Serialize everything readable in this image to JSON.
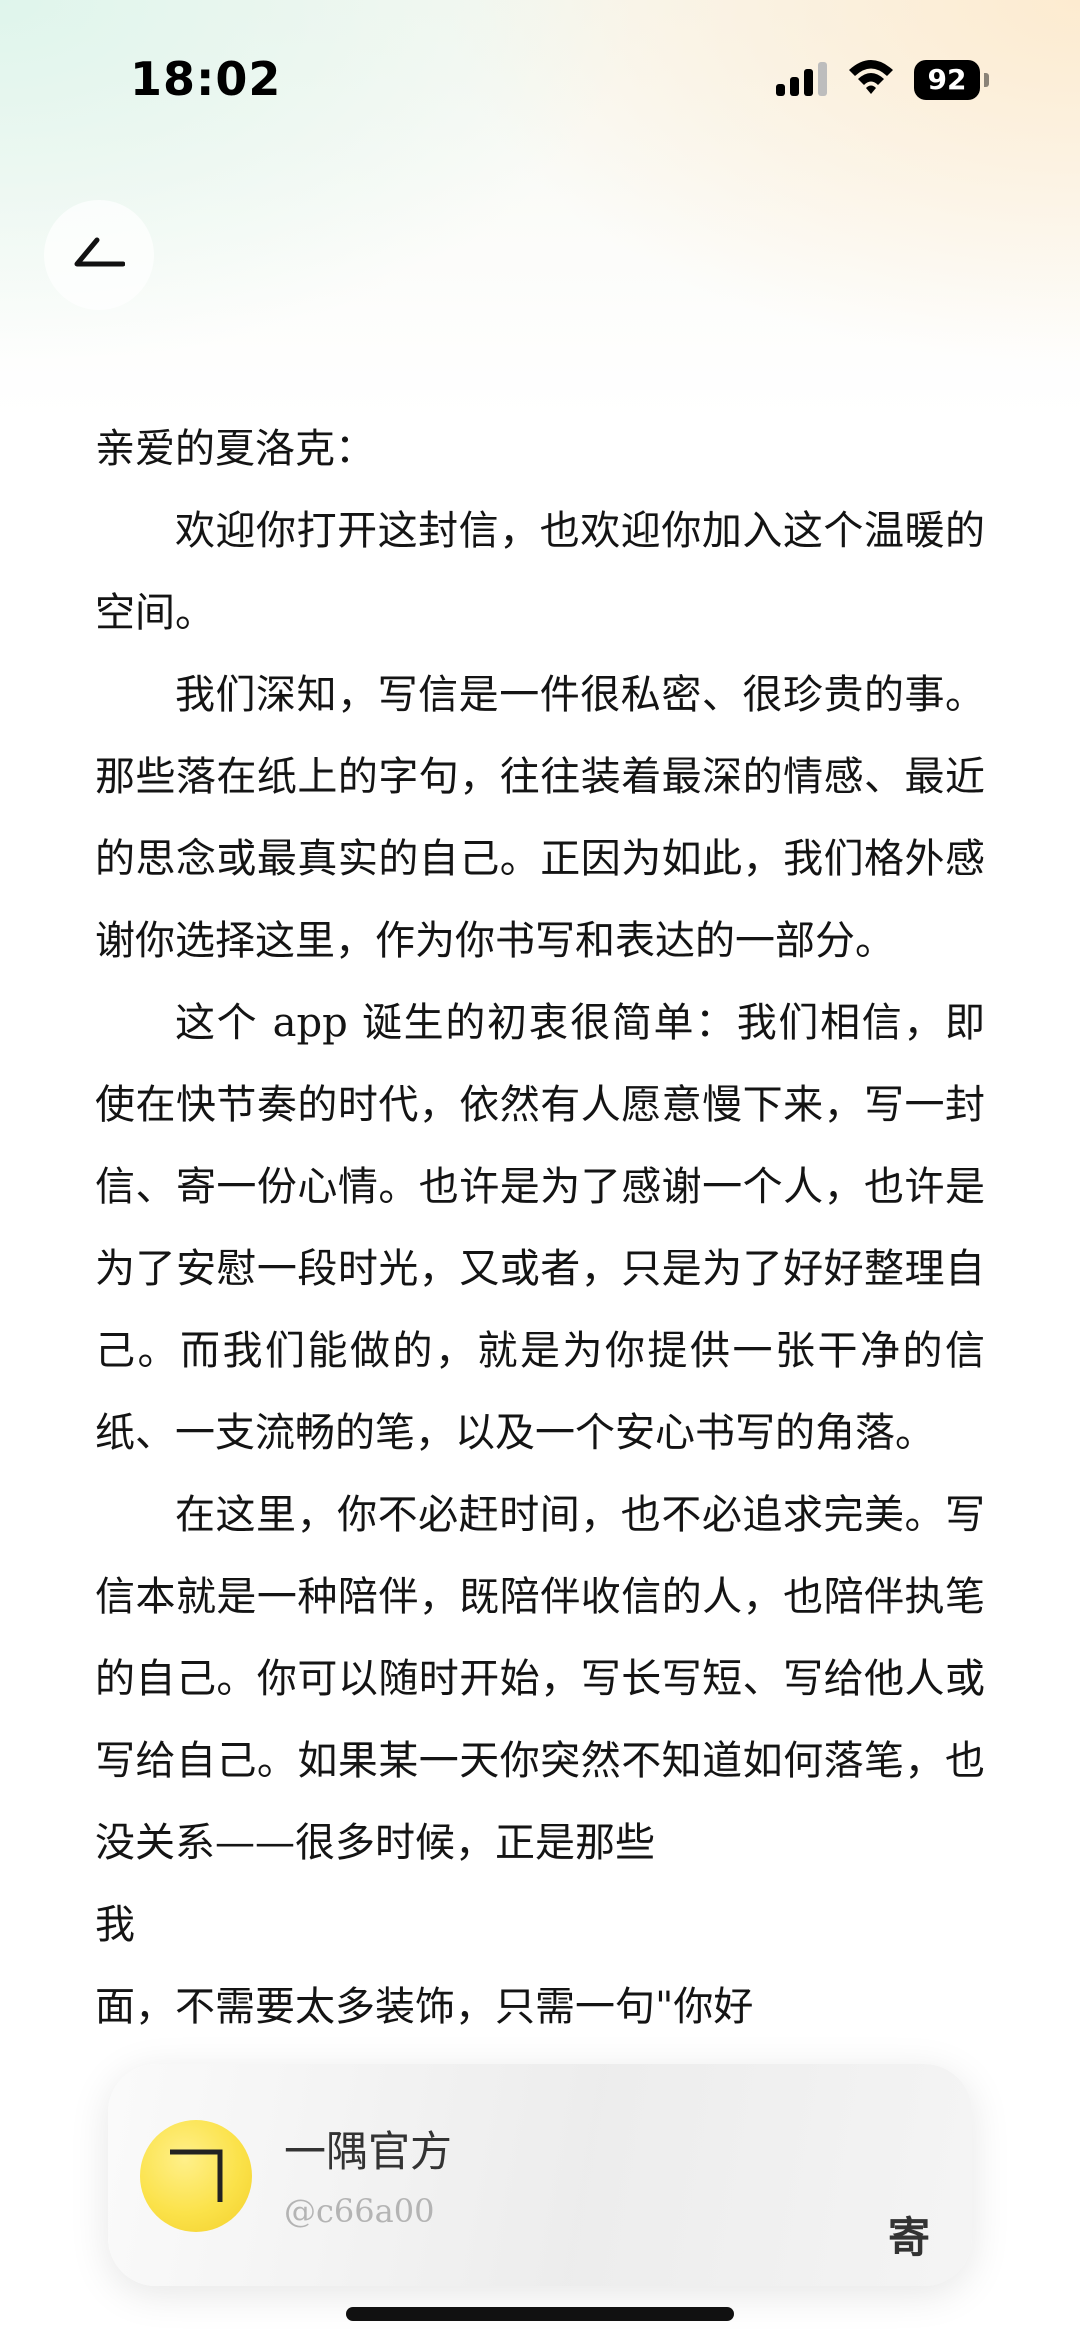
{
  "status_bar": {
    "time": "18:02",
    "battery_level": "92",
    "icons": [
      "cellular-signal-icon",
      "wifi-icon",
      "battery-icon"
    ]
  },
  "nav": {
    "back_icon": "back-arrow-icon"
  },
  "letter": {
    "greeting": "亲爱的夏洛克：",
    "paragraphs": [
      "欢迎你打开这封信，也欢迎你加入这个温暖的空间。",
      "我们深知，写信是一件很私密、很珍贵的事。那些落在纸上的字句，往往装着最深的情感、最近的思念或最真实的自己。正因为如此，我们格外感谢你选择这里，作为你书写和表达的一部分。",
      "这个 app 诞生的初衷很简单：我们相信，即使在快节奏的时代，依然有人愿意慢下来，写一封信、寄一份心情。也许是为了感谢一个人，也许是为了安慰一段时光，又或者，只是为了好好整理自己。而我们能做的，就是为你提供一张干净的信纸、一支流畅的笔，以及一个安心书写的角落。",
      "在这里，你不必赶时间，也不必追求完美。写信本就是一种陪伴，既陪伴收信的人，也陪伴执笔的自己。你可以随时开始，写长写短、写给他人或写给自己。如果某一天你突然不知道如何落笔，也没关系——很多时候，正是那些",
      "我",
      "面，不需要太多装饰，只需一句\"你好"
    ]
  },
  "sender_card": {
    "name": "一隅官方",
    "handle": "@c66a00",
    "send_label": "寄",
    "avatar_color": "#fbe24a"
  },
  "colors": {
    "text": "#141414",
    "accent_yellow": "#fbe24a",
    "muted": "#b4b4b4"
  }
}
